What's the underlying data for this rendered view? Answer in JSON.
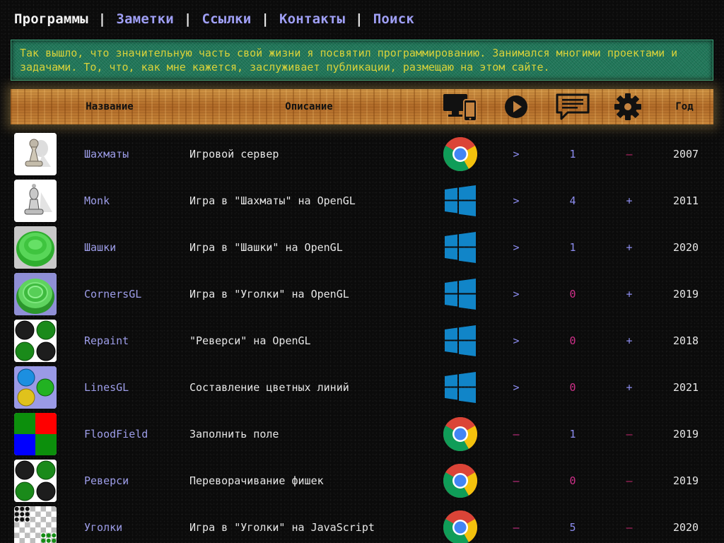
{
  "nav": {
    "items": [
      "Программы",
      "Заметки",
      "Ссылки",
      "Контакты",
      "Поиск"
    ],
    "separator": "|",
    "active_index": 0
  },
  "intro": {
    "text": "Так вышло, что значительную часть свой жизни я посвятил программированию. Занимался многими проектами и задачами. То, что, как мне кажется, заслуживает публикации, размещаю на этом сайте."
  },
  "table": {
    "headers": {
      "name": "Название",
      "description": "Описание",
      "year": "Год"
    },
    "header_icons": [
      "devices-icon",
      "play-icon",
      "comments-icon",
      "gear-icon"
    ],
    "rows": [
      {
        "thumb": "chess-pawn-icon",
        "name": "Шахматы",
        "description": "Игровой сервер",
        "platform": "chrome-icon",
        "run": ">",
        "comments": "1",
        "source": "–",
        "year": "2007"
      },
      {
        "thumb": "chess-bishop-icon",
        "name": "Monk",
        "description": "Игра в \"Шахматы\" на OpenGL",
        "platform": "windows-icon",
        "run": ">",
        "comments": "4",
        "source": "+",
        "year": "2011"
      },
      {
        "thumb": "green-checker-icon",
        "name": "Шашки",
        "description": "Игра в \"Шашки\" на OpenGL",
        "platform": "windows-icon",
        "run": ">",
        "comments": "1",
        "source": "+",
        "year": "2020"
      },
      {
        "thumb": "green-checker-blue-icon",
        "name": "CornersGL",
        "description": "Игра в \"Уголки\" на OpenGL",
        "platform": "windows-icon",
        "run": ">",
        "comments": "0",
        "source": "+",
        "year": "2019"
      },
      {
        "thumb": "reversi-discs-icon",
        "name": "Repaint",
        "description": "\"Реверси\" на OpenGL",
        "platform": "windows-icon",
        "run": ">",
        "comments": "0",
        "source": "+",
        "year": "2018"
      },
      {
        "thumb": "color-balls-icon",
        "name": "LinesGL",
        "description": "Составление цветных линий",
        "platform": "windows-icon",
        "run": ">",
        "comments": "0",
        "source": "+",
        "year": "2021"
      },
      {
        "thumb": "color-squares-icon",
        "name": "FloodField",
        "description": "Заполнить поле",
        "platform": "chrome-icon",
        "run": "–",
        "comments": "1",
        "source": "–",
        "year": "2019"
      },
      {
        "thumb": "reversi-discs-icon",
        "name": "Реверси",
        "description": "Переворачивание фишек",
        "platform": "chrome-icon",
        "run": "–",
        "comments": "0",
        "source": "–",
        "year": "2019"
      },
      {
        "thumb": "checkerboard-icon",
        "name": "Уголки",
        "description": "Игра в \"Уголки\" на JavaScript",
        "platform": "chrome-icon",
        "run": "–",
        "comments": "5",
        "source": "–",
        "year": "2020"
      }
    ]
  },
  "colors": {
    "link": "#9d9de8",
    "text": "#e6e6e6",
    "intro_text": "#d8d23a",
    "intro_bg": "#237a5c",
    "accent_pink": "#d0308a"
  }
}
